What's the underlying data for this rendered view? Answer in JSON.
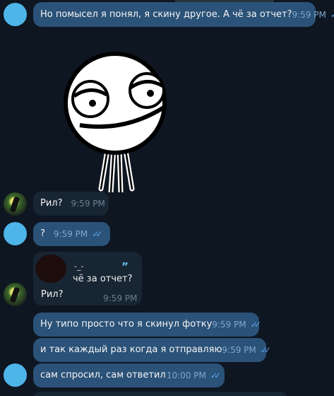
{
  "messages": [
    {
      "text": "Но помысел я понял, я скину другое.  А чё за отчет?",
      "time": "9:59 PM",
      "ticks": "✓✓"
    },
    {
      "text": "Рил?",
      "time": "9:59 PM"
    },
    {
      "text": "?",
      "time": "9:59 PM",
      "ticks": "✓✓"
    },
    {
      "reply_name": "-_-",
      "reply_text": "чё за отчет?",
      "reply_mark": "”",
      "text": "Рил?",
      "time": "9:59 PM"
    },
    {
      "text": "Ну типо просто что я скинул фотку",
      "time": "9:59 PM",
      "ticks": "✓✓"
    },
    {
      "text": "и так каждый раз когда я отправляю",
      "time": "9:59 PM",
      "ticks": "✓✓"
    },
    {
      "text": "сам  спросил, сам ответил",
      "time": "10:00 PM",
      "ticks": "✓✓"
    }
  ],
  "colors": {
    "background": "#0e1621",
    "outgoing_bubble": "#2b5278",
    "incoming_bubble": "#182533",
    "avatar_blue": "#4eb5e8",
    "tick": "#5fa8f0"
  },
  "icons": [
    "double-check-icon",
    "sticker-face",
    "avatar-blue",
    "avatar-photo"
  ]
}
